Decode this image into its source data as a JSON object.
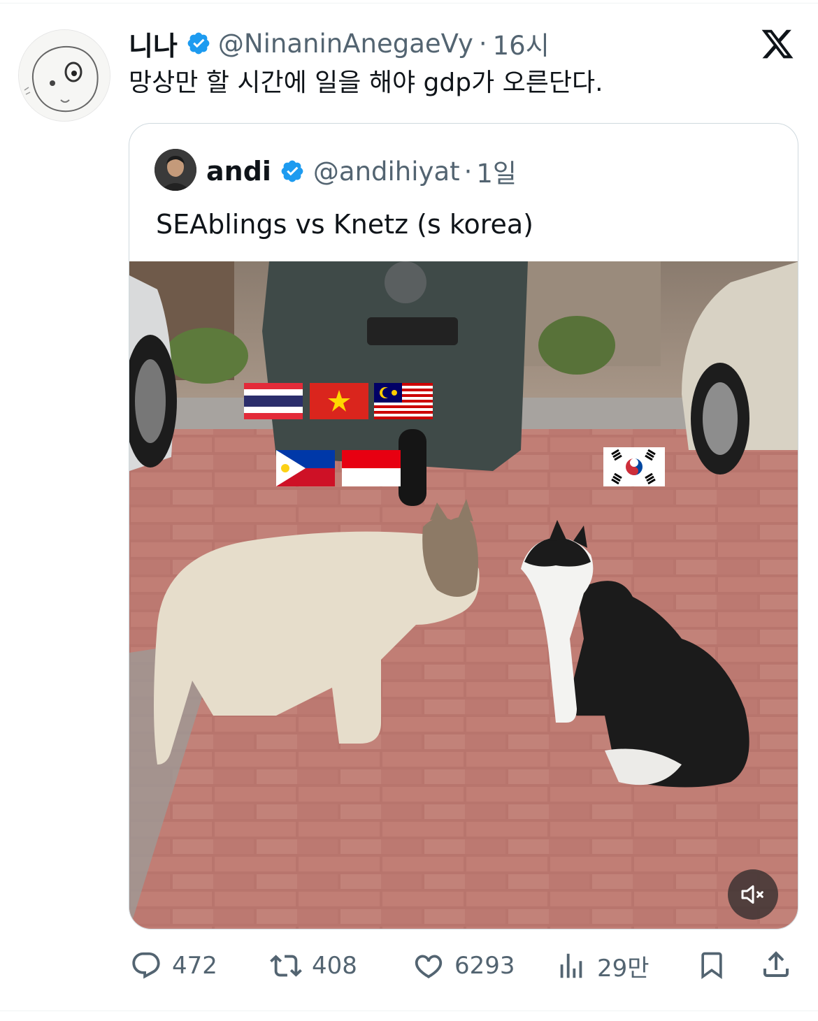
{
  "tweet": {
    "author": {
      "name": "니나",
      "handle": "@NinaninAnegaeVy",
      "time": "16시",
      "separator": "·"
    },
    "text": "망상만 할 시간에 일을 해야 gdp가 오른단다.",
    "logo": "x-logo-icon",
    "quoted": {
      "author": {
        "name": "andi",
        "handle": "@andihiyat",
        "time": "1일",
        "separator": "·"
      },
      "text": "SEAblings vs Knetz (s korea)",
      "media": {
        "type": "video",
        "description_icons": [
          "thailand-flag",
          "vietnam-flag",
          "malaysia-flag",
          "philippines-flag",
          "indonesia-flag",
          "south-korea-flag"
        ],
        "mute_icon": "speaker-muted-icon"
      }
    },
    "actions": {
      "replies": "472",
      "retweets": "408",
      "likes": "6293",
      "views": "29만"
    }
  },
  "colors": {
    "text_primary": "#0f1419",
    "text_secondary": "#536471",
    "verified_blue": "#1d9bf0",
    "border": "#cfd9de"
  }
}
